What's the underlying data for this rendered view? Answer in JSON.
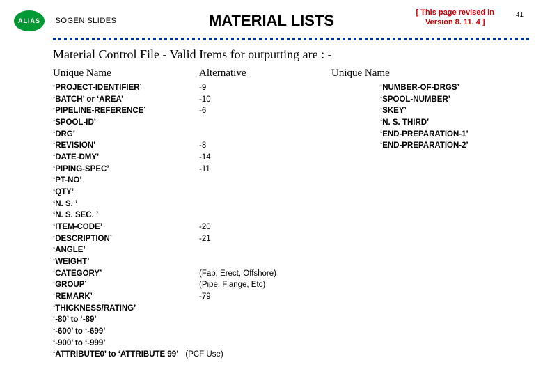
{
  "header": {
    "badge": "ALIAS",
    "sequence": "ISOGEN SLIDES",
    "title": "MATERIAL LISTS",
    "revision_note_line1": "[ This page revised in",
    "revision_note_line2": "Version 8. 11. 4 ]",
    "page_number": "41"
  },
  "subheading": "Material Control File - Valid Items for outputting are : -",
  "column_headers": {
    "col1": "Unique Name",
    "col2": "Alternative",
    "col3": "Unique Name"
  },
  "rows": [
    {
      "name": "‘PROJECT-IDENTIFIER’",
      "alt": "-9"
    },
    {
      "name": "‘BATCH’ or ‘AREA’",
      "alt": "-10"
    },
    {
      "name": "‘PIPELINE-REFERENCE’",
      "alt": "-6"
    },
    {
      "name": "‘SPOOL-ID’",
      "alt": ""
    },
    {
      "name": "‘DRG’",
      "alt": ""
    },
    {
      "name": "‘REVISION’",
      "alt": "-8"
    },
    {
      "name": "‘DATE-DMY’",
      "alt": "-14"
    },
    {
      "name": "‘PIPING-SPEC’",
      "alt": "-11"
    },
    {
      "name": "‘PT-NO’",
      "alt": ""
    },
    {
      "name": "‘QTY’",
      "alt": ""
    },
    {
      "name": "‘N. S. ’",
      "alt": ""
    },
    {
      "name": "‘N. S. SEC. ’",
      "alt": ""
    },
    {
      "name": "‘ITEM-CODE’",
      "alt": "-20"
    },
    {
      "name": "‘DESCRIPTION’",
      "alt": "-21"
    },
    {
      "name": "‘ANGLE’",
      "alt": ""
    },
    {
      "name": "‘WEIGHT’",
      "alt": ""
    },
    {
      "name": "‘CATEGORY’",
      "alt": "(Fab, Erect, Offshore)"
    },
    {
      "name": "‘GROUP’",
      "alt": "(Pipe, Flange, Etc)"
    },
    {
      "name": "‘REMARK’",
      "alt": "-79"
    },
    {
      "name": "‘THICKNESS/RATING’",
      "alt": ""
    },
    {
      "name": "‘-80’ to ‘-89’",
      "alt": ""
    },
    {
      "name": "‘-600’ to ‘-699’",
      "alt": ""
    },
    {
      "name": "‘-900’ to ‘-999’",
      "alt": ""
    }
  ],
  "col3_items": [
    "‘NUMBER-OF-DRGS’",
    "‘SPOOL-NUMBER’",
    "‘SKEY’",
    "‘N. S. THIRD’",
    "‘END-PREPARATION-1’",
    "‘END-PREPARATION-2’"
  ],
  "attribute_line": {
    "name": "‘ATTRIBUTE0’ to ‘ATTRIBUTE 99’",
    "note": "(PCF Use)"
  }
}
